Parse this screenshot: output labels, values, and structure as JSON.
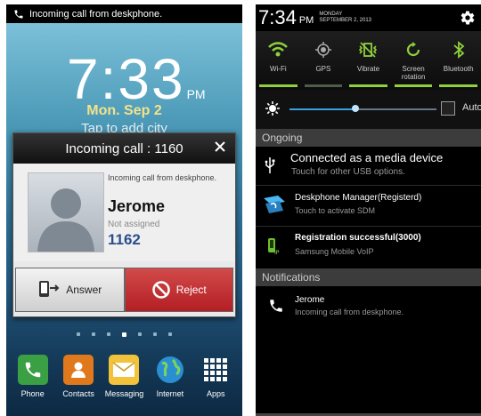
{
  "left": {
    "status_text": "Incoming call from deskphone.",
    "clock_time": "7:33",
    "clock_ampm": "PM",
    "date": "Mon. Sep 2",
    "hint": "Tap to add city",
    "dialog": {
      "title": "Incoming call : 1160",
      "close": "✕",
      "description": "Incoming call from deskphone.",
      "name": "Jerome",
      "status": "Not assigned",
      "number": "1162",
      "answer_label": "Answer",
      "reject_label": "Reject"
    },
    "page_dots": 7,
    "active_dot": 3,
    "dock": [
      {
        "label": "Phone",
        "icon": "phone-icon",
        "color": "#3aa043"
      },
      {
        "label": "Contacts",
        "icon": "contacts-icon",
        "color": "#e0781c"
      },
      {
        "label": "Messaging",
        "icon": "messaging-icon",
        "color": "#f2c23a"
      },
      {
        "label": "Internet",
        "icon": "globe-icon",
        "color": "#2a8fd0"
      },
      {
        "label": "Apps",
        "icon": "apps-grid-icon",
        "color": "#cccccc"
      }
    ]
  },
  "right": {
    "time": "7:34",
    "ampm": "PM",
    "day": "MONDAY",
    "date": "SEPTEMBER 2, 2013",
    "toggles": [
      {
        "label": "Wi-Fi",
        "icon": "wifi-icon",
        "on": true
      },
      {
        "label": "GPS",
        "icon": "gps-icon",
        "on": false
      },
      {
        "label": "Vibrate",
        "icon": "vibrate-icon",
        "on": true
      },
      {
        "label": "Screen\nrotation",
        "icon": "rotation-icon",
        "on": true
      },
      {
        "label": "Bluetooth",
        "icon": "bluetooth-icon",
        "on": true
      }
    ],
    "brightness_level": 0.45,
    "auto_label": "Auto",
    "ongoing_header": "Ongoing",
    "ongoing": [
      {
        "title": "Connected as a media device",
        "subtitle": "Touch for other USB options.",
        "icon": "usb-icon"
      },
      {
        "title": "Deskphone Manager(Registerd)",
        "subtitle": "Touch to activate SDM",
        "icon": "deskphone-manager-icon"
      },
      {
        "title": "Registration successful(3000)",
        "subtitle": "Samsung Mobile VoIP",
        "icon": "voip-icon"
      }
    ],
    "notifications_header": "Notifications",
    "notifications": [
      {
        "title": "Jerome",
        "subtitle": "Incoming call from deskphone.",
        "icon": "phone-icon"
      }
    ]
  }
}
